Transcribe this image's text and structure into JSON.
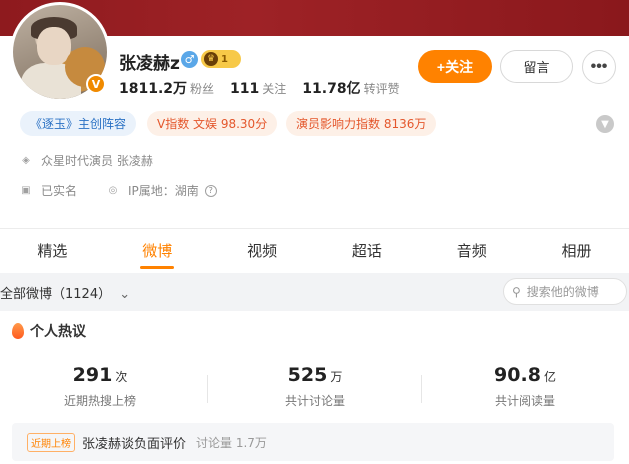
{
  "profile": {
    "name": "张凌赫z",
    "vip_level": "1",
    "verify_mark": "V",
    "gender_symbol": "♂",
    "stats": [
      {
        "value": "1811.2万",
        "label": "粉丝"
      },
      {
        "value": "111",
        "label": "关注"
      },
      {
        "value": "11.78亿",
        "label": "转评赞"
      }
    ],
    "follow_label": "+关注",
    "message_label": "留言",
    "more_label": "•••",
    "tags": [
      "《逐玉》主创阵容",
      "V指数 文娱 98.30分",
      "演员影响力指数 8136万"
    ],
    "company": "众星时代演员 张凌赫",
    "real_name": "已实名",
    "ip_location": "IP属地：湖南",
    "colors": {
      "accent": "#ff8200",
      "banner": "#9e2226",
      "tag_blue": "#2a71c4",
      "tag_red": "#e4572c"
    }
  },
  "tabs": [
    "精选",
    "微博",
    "视频",
    "超话",
    "音频",
    "相册"
  ],
  "active_tab": "微博",
  "filter": {
    "label": "全部微博（1124）",
    "search_placeholder": "搜索他的微博"
  },
  "hot": {
    "title": "个人热议",
    "metrics": [
      {
        "value": "291",
        "unit": "次",
        "label": "近期热搜上榜"
      },
      {
        "value": "525",
        "unit": "万",
        "label": "共计讨论量"
      },
      {
        "value": "90.8",
        "unit": "亿",
        "label": "共计阅读量"
      }
    ],
    "item": {
      "badge": "近期上榜",
      "topic": "张凌赫谈负面评价",
      "count": "讨论量 1.7万"
    }
  }
}
